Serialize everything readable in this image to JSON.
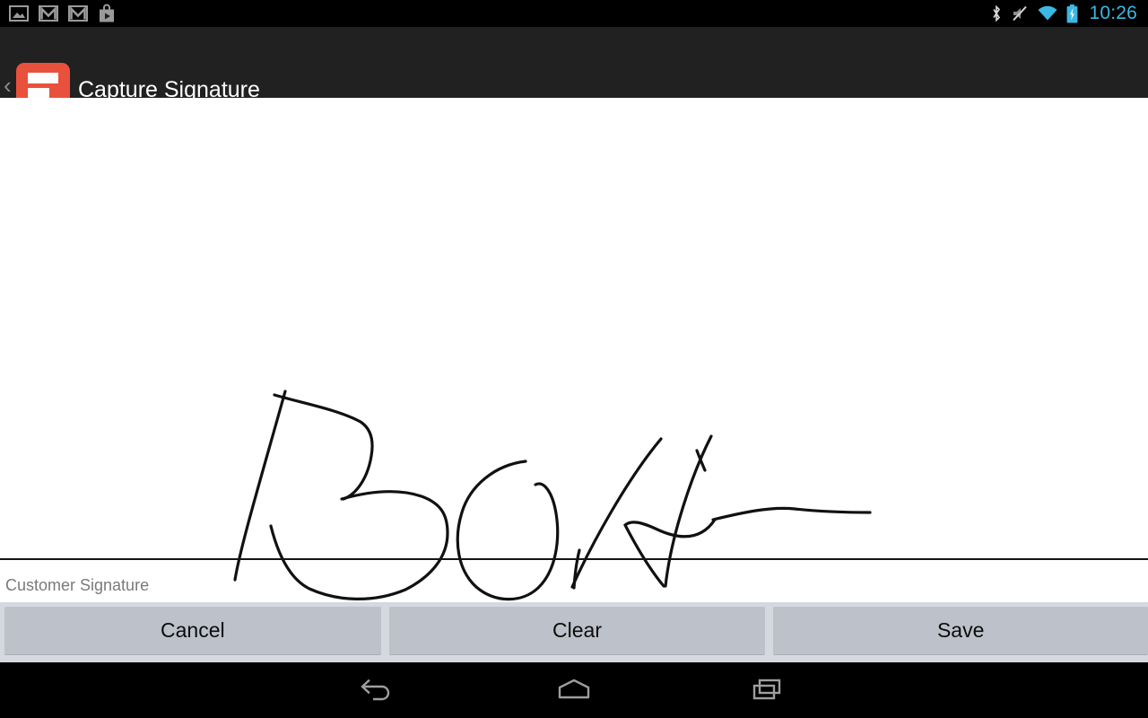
{
  "status_bar": {
    "notifications": [
      {
        "name": "image-notification-icon",
        "label": "Screenshot"
      },
      {
        "name": "gmail-notification-icon",
        "label": "Gmail"
      },
      {
        "name": "gmail-notification-icon-2",
        "label": "Gmail"
      },
      {
        "name": "play-store-notification-icon",
        "label": "Play Store"
      }
    ],
    "system_icons": [
      {
        "name": "bluetooth-icon",
        "label": "Bluetooth"
      },
      {
        "name": "mute-icon",
        "label": "Silent"
      },
      {
        "name": "wifi-icon",
        "label": "Wi-Fi"
      },
      {
        "name": "battery-charging-icon",
        "label": "Battery charging"
      }
    ],
    "clock": "10:26",
    "clock_color": "#3bb8e4",
    "background": "#000000"
  },
  "action_bar": {
    "title": "Capture Signature",
    "back_label": "‹",
    "logo_alt": "App logo",
    "background": "#212121",
    "accent": "#e8513c"
  },
  "signature_pad": {
    "caption": "Customer Signature",
    "stroke_color": "#111111",
    "background": "#ffffff",
    "has_signature": true,
    "strokes": [
      "M 262 537 C 268 500 292 420 318 327",
      "M 306 331 C 336 340 376 347 402 361 C 414 369 417 382 414 399 C 410 424 397 442 383 447",
      "M 381 447 C 406 440 440 434 470 444 C 492 452 499 465 499 485 C 499 512 480 534 452 548 C 416 563 376 561 345 547 C 323 536 310 509 302 477",
      "M 586 405 C 552 409 524 432 515 462 C 505 494 511 527 531 545 C 552 563 582 563 600 546 C 619 528 625 494 620 463 C 616 439 606 426 597 431",
      "M 638 545 C 660 496 700 424 737 380",
      "M 640 546 C 641 530 643 516 646 504",
      "M 793 377 C 771 420 748 489 742 544",
      "M 777 393 C 780 401 783 408 786 415",
      "M 697 476 C 704 470 716 473 733 481 C 757 492 781 494 797 470",
      "M 697 476 C 710 501 725 526 740 544",
      "M 795 470 C 824 463 858 455 886 458 C 914 461 944 462 970 462"
    ]
  },
  "buttons": [
    {
      "name": "cancel-button",
      "label": "Cancel"
    },
    {
      "name": "clear-button",
      "label": "Clear"
    },
    {
      "name": "save-button",
      "label": "Save"
    }
  ],
  "nav_bar": {
    "items": [
      {
        "name": "nav-back-button",
        "label": "Back"
      },
      {
        "name": "nav-home-button",
        "label": "Home"
      },
      {
        "name": "nav-recents-button",
        "label": "Recents"
      }
    ],
    "background": "#000000"
  }
}
